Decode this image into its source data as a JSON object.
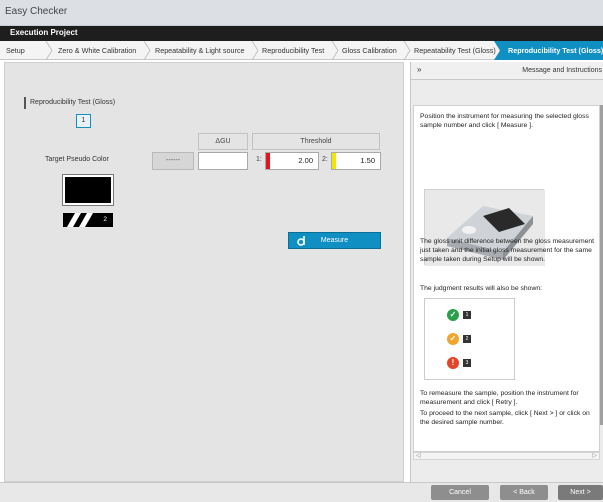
{
  "window": {
    "title": "Easy Checker"
  },
  "project": {
    "title": "Execution Project"
  },
  "tabs": [
    {
      "label": "Setup"
    },
    {
      "label": "Zero & White Calibration"
    },
    {
      "label": "Repeatability & Light source"
    },
    {
      "label": "Reproducibility Test"
    },
    {
      "label": "Gloss Calibration"
    },
    {
      "label": "Repeatability Test (Gloss)"
    },
    {
      "label": "Reproducibility Test (Gloss)"
    }
  ],
  "main": {
    "section_label": "Reproducibility Test (Gloss)",
    "sample_number": "1",
    "target_label": "Target Pseudo Color",
    "swatch_number": "2",
    "table": {
      "dgu_header": "ΔGU",
      "threshold_header": "Threshold",
      "dash_button": "------",
      "dgu_value": "",
      "threshold1_index": "1:",
      "threshold1_value": "2.00",
      "threshold1_color": "#e8141c",
      "threshold2_index": "2:",
      "threshold2_value": "1.50",
      "threshold2_color": "#f2e600"
    },
    "measure_button": "Measure"
  },
  "panel": {
    "collapse_glyph": "»",
    "title": "Message and Instructions",
    "para1": "Position the instrument for measuring the selected gloss sample number and click [ Measure ].",
    "para2": "The gloss unit difference between the gloss measurement just taken and the initial gloss measurement for the same sample taken during Setup will be shown.",
    "para3": "The judgment results will also be shown:",
    "judgments": [
      {
        "symbol": "✓",
        "color": "#2aa04a",
        "num": "1"
      },
      {
        "symbol": "✓",
        "color": "#f2a52c",
        "num": "2"
      },
      {
        "symbol": "!",
        "color": "#e2452a",
        "num": "3"
      }
    ],
    "para4": "To remeasure the sample, position the instrument for measurement and click [ Retry ].",
    "para5": "To proceed to the next sample, click [ Next > ] or click on the desired sample number."
  },
  "footer": {
    "cancel": "Cancel",
    "back": "< Back",
    "next": "Next >"
  },
  "colors": {
    "accent": "#0f8fc2",
    "inactive_button": "#8e8e8e"
  }
}
